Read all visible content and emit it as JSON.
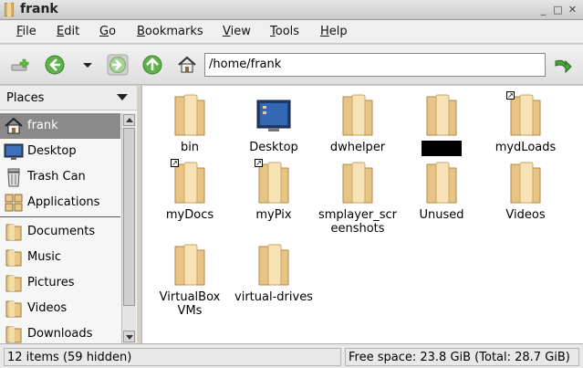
{
  "window": {
    "title": "frank"
  },
  "menu": [
    "File",
    "Edit",
    "Go",
    "Bookmarks",
    "View",
    "Tools",
    "Help"
  ],
  "location": {
    "path": "/home/frank"
  },
  "sidebar": {
    "header": "Places",
    "items": [
      "frank",
      "Desktop",
      "Trash Can",
      "Applications",
      "Documents",
      "Music",
      "Pictures",
      "Videos",
      "Downloads"
    ]
  },
  "files": [
    {
      "name": "bin",
      "icon": "folder-icon"
    },
    {
      "name": "Desktop",
      "icon": "desktop-folder-icon"
    },
    {
      "name": "dwhelper",
      "icon": "folder-icon"
    },
    {
      "name": "",
      "icon": "folder-icon",
      "redacted": true
    },
    {
      "name": "mydLoads",
      "icon": "folder-symlink-icon"
    },
    {
      "name": "myDocs",
      "icon": "folder-symlink-icon"
    },
    {
      "name": "myPix",
      "icon": "folder-symlink-icon"
    },
    {
      "name": "smplayer_screenshots",
      "icon": "folder-icon"
    },
    {
      "name": "Unused",
      "icon": "folder-icon"
    },
    {
      "name": "Videos",
      "icon": "folder-icon"
    },
    {
      "name": "VirtualBox VMs",
      "icon": "folder-icon"
    },
    {
      "name": "virtual-drives",
      "icon": "folder-icon"
    }
  ],
  "status": {
    "items": "12 items (59 hidden)",
    "free_space": "Free space: 23.8 GiB (Total: 28.7 GiB)"
  },
  "colors": {
    "accent": "#8a8a8a",
    "folder": "#e8c88a",
    "go_green": "#4aa13a"
  }
}
